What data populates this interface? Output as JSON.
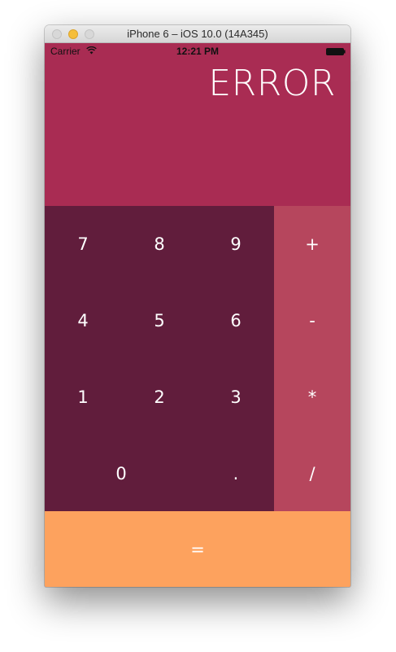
{
  "window": {
    "title": "iPhone 6 – iOS 10.0 (14A345)"
  },
  "status_bar": {
    "carrier": "Carrier",
    "time": "12:21 PM"
  },
  "display": {
    "value": "ERROR"
  },
  "keys": {
    "digits": [
      "7",
      "8",
      "9",
      "4",
      "5",
      "6",
      "1",
      "2",
      "3"
    ],
    "zero": "0",
    "decimal": ".",
    "operators": [
      "+",
      "-",
      "*",
      "/"
    ],
    "equals": "="
  },
  "colors": {
    "display_bg": "#a92c53",
    "keypad_bg": "#611d3c",
    "operator_bg": "#b6465d",
    "equals_bg": "#fda25e",
    "text": "#ffffff"
  }
}
